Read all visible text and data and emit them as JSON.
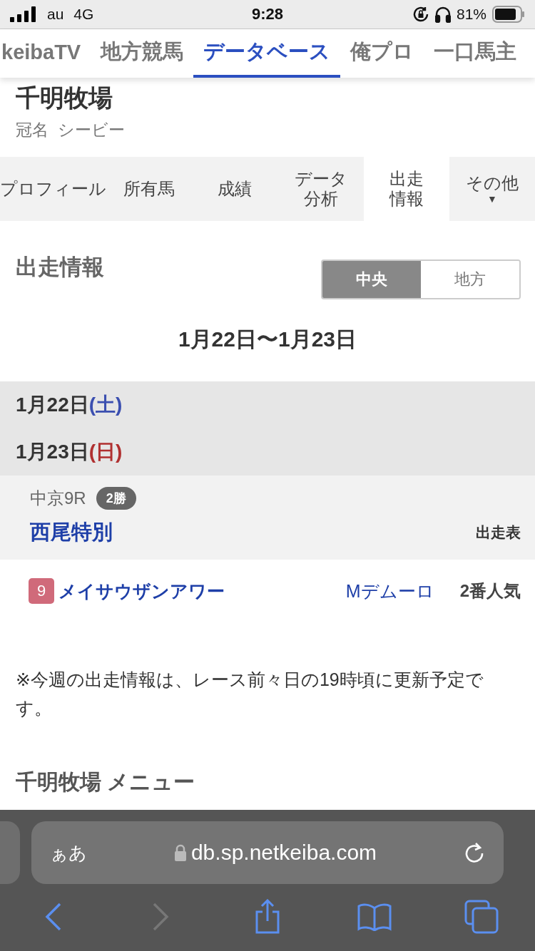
{
  "status_bar": {
    "carrier": "au",
    "network": "4G",
    "time": "9:28",
    "battery": "81%"
  },
  "site_nav": [
    {
      "label": "keibaTV",
      "selected": false
    },
    {
      "label": "地方競馬",
      "selected": false
    },
    {
      "label": "データベース",
      "selected": true
    },
    {
      "label": "俺プロ",
      "selected": false
    },
    {
      "label": "一口馬主",
      "selected": false
    }
  ],
  "header": {
    "title": "千明牧場",
    "subtitle": "冠名  シービー"
  },
  "sub_tabs": [
    {
      "label": "プロフィール",
      "selected": false
    },
    {
      "label": "所有馬",
      "selected": false
    },
    {
      "label": "成績",
      "selected": false
    },
    {
      "label": "データ分析",
      "selected": false,
      "kind": "stacked"
    },
    {
      "label": "出走情報",
      "selected": true,
      "kind": "stacked"
    },
    {
      "label": "その他",
      "selected": false,
      "kind": "dropdown",
      "caret": "▼"
    }
  ],
  "section": {
    "title": "出走情報",
    "toggle": [
      {
        "label": "中央",
        "selected": true
      },
      {
        "label": "地方",
        "selected": false
      }
    ],
    "date_range": "1月22日〜1月23日"
  },
  "days": [
    {
      "date": "1月22日",
      "weekday": "(土)",
      "color": "#3b4fb0"
    },
    {
      "date": "1月23日",
      "weekday": "(日)",
      "color": "#b03030"
    }
  ],
  "race": {
    "venue": "中京9R",
    "class_badge": "2勝",
    "name": "西尾特別",
    "link": "出走表"
  },
  "entries": [
    {
      "number": "9",
      "color": "#d06a7a",
      "horse": "メイサウザンアワー",
      "jockey": "Mデムーロ",
      "popularity": "2番人気"
    }
  ],
  "note": "※今週の出走情報は、レース前々日の19時頃に更新予定です。",
  "menu_heading": "千明牧場 メニュー",
  "browser": {
    "text_size": "ぁあ",
    "url": "db.sp.netkeiba.com",
    "toolbar": [
      {
        "kind": "back",
        "disabled": false
      },
      {
        "kind": "forward",
        "disabled": true
      },
      {
        "kind": "share",
        "disabled": false
      },
      {
        "kind": "bookmarks",
        "disabled": false
      },
      {
        "kind": "tabs",
        "disabled": false
      }
    ]
  }
}
